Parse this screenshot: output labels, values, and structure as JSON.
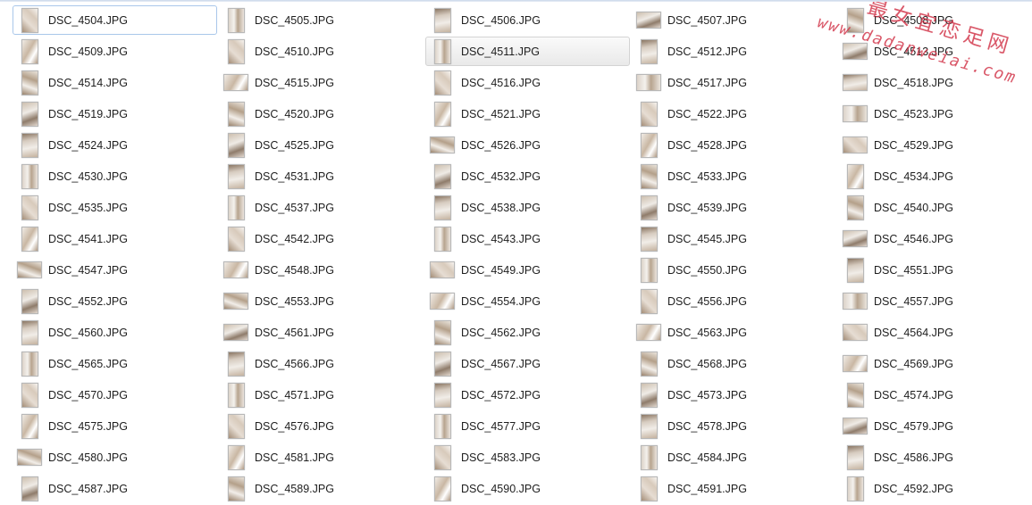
{
  "files": [
    {
      "name": "DSC_4504.JPG",
      "o": "p",
      "state": "focused"
    },
    {
      "name": "DSC_4505.JPG",
      "o": "p"
    },
    {
      "name": "DSC_4506.JPG",
      "o": "p"
    },
    {
      "name": "DSC_4507.JPG",
      "o": "l"
    },
    {
      "name": "DSC_4508.JPG",
      "o": "p"
    },
    {
      "name": "DSC_4509.JPG",
      "o": "p"
    },
    {
      "name": "DSC_4510.JPG",
      "o": "p"
    },
    {
      "name": "DSC_4511.JPG",
      "o": "p",
      "state": "hovered"
    },
    {
      "name": "DSC_4512.JPG",
      "o": "p"
    },
    {
      "name": "DSC_4513.JPG",
      "o": "l"
    },
    {
      "name": "DSC_4514.JPG",
      "o": "p"
    },
    {
      "name": "DSC_4515.JPG",
      "o": "l"
    },
    {
      "name": "DSC_4516.JPG",
      "o": "p"
    },
    {
      "name": "DSC_4517.JPG",
      "o": "l"
    },
    {
      "name": "DSC_4518.JPG",
      "o": "l"
    },
    {
      "name": "DSC_4519.JPG",
      "o": "p"
    },
    {
      "name": "DSC_4520.JPG",
      "o": "p"
    },
    {
      "name": "DSC_4521.JPG",
      "o": "p"
    },
    {
      "name": "DSC_4522.JPG",
      "o": "p"
    },
    {
      "name": "DSC_4523.JPG",
      "o": "l"
    },
    {
      "name": "DSC_4524.JPG",
      "o": "p"
    },
    {
      "name": "DSC_4525.JPG",
      "o": "p"
    },
    {
      "name": "DSC_4526.JPG",
      "o": "l"
    },
    {
      "name": "DSC_4528.JPG",
      "o": "p"
    },
    {
      "name": "DSC_4529.JPG",
      "o": "l"
    },
    {
      "name": "DSC_4530.JPG",
      "o": "p"
    },
    {
      "name": "DSC_4531.JPG",
      "o": "p"
    },
    {
      "name": "DSC_4532.JPG",
      "o": "p"
    },
    {
      "name": "DSC_4533.JPG",
      "o": "p"
    },
    {
      "name": "DSC_4534.JPG",
      "o": "p"
    },
    {
      "name": "DSC_4535.JPG",
      "o": "p"
    },
    {
      "name": "DSC_4537.JPG",
      "o": "p"
    },
    {
      "name": "DSC_4538.JPG",
      "o": "p"
    },
    {
      "name": "DSC_4539.JPG",
      "o": "p"
    },
    {
      "name": "DSC_4540.JPG",
      "o": "p"
    },
    {
      "name": "DSC_4541.JPG",
      "o": "p"
    },
    {
      "name": "DSC_4542.JPG",
      "o": "p"
    },
    {
      "name": "DSC_4543.JPG",
      "o": "p"
    },
    {
      "name": "DSC_4545.JPG",
      "o": "p"
    },
    {
      "name": "DSC_4546.JPG",
      "o": "l"
    },
    {
      "name": "DSC_4547.JPG",
      "o": "l"
    },
    {
      "name": "DSC_4548.JPG",
      "o": "l"
    },
    {
      "name": "DSC_4549.JPG",
      "o": "l"
    },
    {
      "name": "DSC_4550.JPG",
      "o": "p"
    },
    {
      "name": "DSC_4551.JPG",
      "o": "p"
    },
    {
      "name": "DSC_4552.JPG",
      "o": "p"
    },
    {
      "name": "DSC_4553.JPG",
      "o": "l"
    },
    {
      "name": "DSC_4554.JPG",
      "o": "l"
    },
    {
      "name": "DSC_4556.JPG",
      "o": "p"
    },
    {
      "name": "DSC_4557.JPG",
      "o": "l"
    },
    {
      "name": "DSC_4560.JPG",
      "o": "p"
    },
    {
      "name": "DSC_4561.JPG",
      "o": "l"
    },
    {
      "name": "DSC_4562.JPG",
      "o": "p"
    },
    {
      "name": "DSC_4563.JPG",
      "o": "l"
    },
    {
      "name": "DSC_4564.JPG",
      "o": "l"
    },
    {
      "name": "DSC_4565.JPG",
      "o": "p"
    },
    {
      "name": "DSC_4566.JPG",
      "o": "p"
    },
    {
      "name": "DSC_4567.JPG",
      "o": "p"
    },
    {
      "name": "DSC_4568.JPG",
      "o": "p"
    },
    {
      "name": "DSC_4569.JPG",
      "o": "l"
    },
    {
      "name": "DSC_4570.JPG",
      "o": "p"
    },
    {
      "name": "DSC_4571.JPG",
      "o": "p"
    },
    {
      "name": "DSC_4572.JPG",
      "o": "p"
    },
    {
      "name": "DSC_4573.JPG",
      "o": "p"
    },
    {
      "name": "DSC_4574.JPG",
      "o": "p"
    },
    {
      "name": "DSC_4575.JPG",
      "o": "p"
    },
    {
      "name": "DSC_4576.JPG",
      "o": "p"
    },
    {
      "name": "DSC_4577.JPG",
      "o": "p"
    },
    {
      "name": "DSC_4578.JPG",
      "o": "p"
    },
    {
      "name": "DSC_4579.JPG",
      "o": "l"
    },
    {
      "name": "DSC_4580.JPG",
      "o": "l"
    },
    {
      "name": "DSC_4581.JPG",
      "o": "p"
    },
    {
      "name": "DSC_4583.JPG",
      "o": "p"
    },
    {
      "name": "DSC_4584.JPG",
      "o": "p"
    },
    {
      "name": "DSC_4586.JPG",
      "o": "p"
    },
    {
      "name": "DSC_4587.JPG",
      "o": "p"
    },
    {
      "name": "DSC_4589.JPG",
      "o": "p"
    },
    {
      "name": "DSC_4590.JPG",
      "o": "p"
    },
    {
      "name": "DSC_4591.JPG",
      "o": "p"
    },
    {
      "name": "DSC_4592.JPG",
      "o": "p"
    }
  ],
  "watermark": {
    "text_cn": "最女宜恋足网",
    "text_url": "www.dadanweiai.com",
    "color": "#d23a4e"
  },
  "colors": {
    "focus_border": "#a9c7ea",
    "hover_border": "#d3d3d3",
    "text": "#1e1e1e"
  }
}
